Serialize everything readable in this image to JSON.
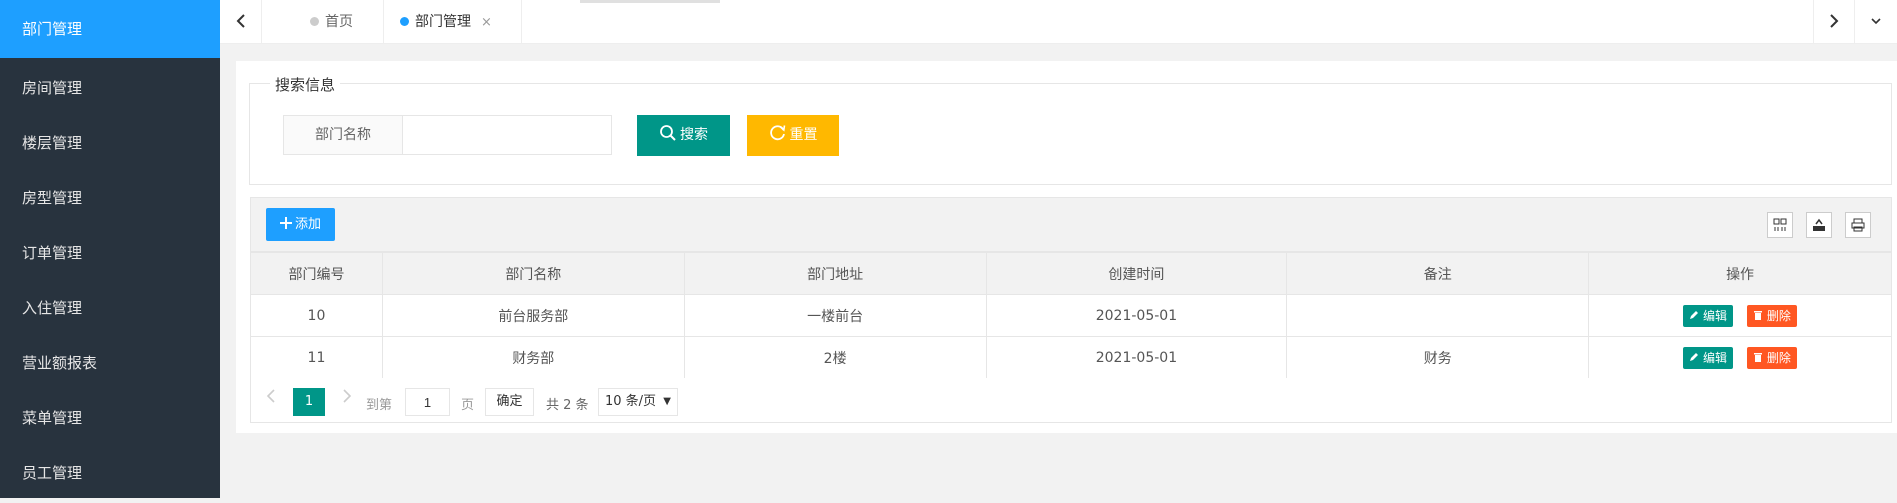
{
  "sidebar": {
    "items": [
      {
        "label": "部门管理",
        "active": true
      },
      {
        "label": "房间管理"
      },
      {
        "label": "楼层管理"
      },
      {
        "label": "房型管理"
      },
      {
        "label": "订单管理"
      },
      {
        "label": "入住管理"
      },
      {
        "label": "营业额报表"
      },
      {
        "label": "菜单管理"
      },
      {
        "label": "员工管理"
      }
    ]
  },
  "tabs": {
    "items": [
      {
        "label": "首页"
      },
      {
        "label": "部门管理",
        "active": true,
        "close": "×"
      }
    ]
  },
  "search": {
    "legend": "搜索信息",
    "field_label": "部门名称",
    "field_value": "",
    "search_label": "搜索",
    "reset_label": "重置"
  },
  "toolbar": {
    "add_label": "添加"
  },
  "table": {
    "headers": [
      "部门编号",
      "部门名称",
      "部门地址",
      "创建时间",
      "备注",
      "操作"
    ],
    "rows": [
      {
        "id": "10",
        "name": "前台服务部",
        "address": "一楼前台",
        "created": "2021-05-01",
        "remark": ""
      },
      {
        "id": "11",
        "name": "财务部",
        "address": "2楼",
        "created": "2021-05-01",
        "remark": "财务"
      }
    ],
    "edit_label": "编辑",
    "delete_label": "删除"
  },
  "pager": {
    "current_page": "1",
    "goto_prefix": "到第",
    "goto_value": "1",
    "goto_suffix": "页",
    "confirm_label": "确定",
    "total_text": "共 2 条",
    "page_size": "10 条/页"
  },
  "colors": {
    "sidebar_bg": "#28333e",
    "active_blue": "#1e9fff",
    "teal": "#009688",
    "yellow": "#ffb800",
    "orange": "#ff5722"
  },
  "icons": [
    "search-icon",
    "refresh-icon",
    "plus-icon",
    "columns-icon",
    "export-icon",
    "print-icon",
    "edit-icon",
    "delete-icon",
    "chevron-left-icon",
    "chevron-right-icon",
    "chevron-down-icon"
  ]
}
